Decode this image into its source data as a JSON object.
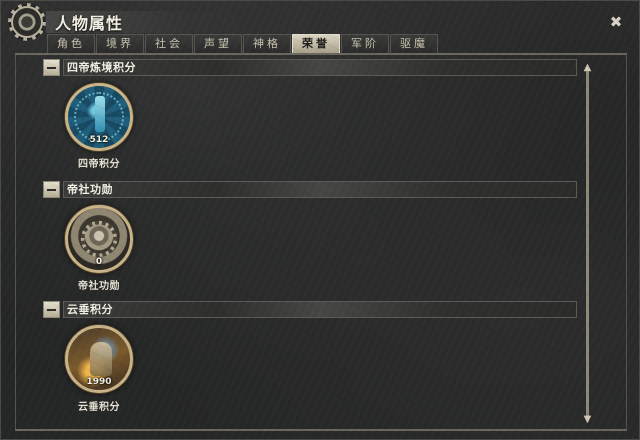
{
  "window": {
    "title": "人物属性"
  },
  "tabs": [
    {
      "label": "角色",
      "active": false
    },
    {
      "label": "境界",
      "active": false
    },
    {
      "label": "社会",
      "active": false
    },
    {
      "label": "声望",
      "active": false
    },
    {
      "label": "神格",
      "active": false
    },
    {
      "label": "荣誉",
      "active": true
    },
    {
      "label": "军阶",
      "active": false
    },
    {
      "label": "驱魔",
      "active": false
    }
  ],
  "sections": [
    {
      "header": "四帝炼境积分",
      "item": {
        "value": "512",
        "caption": "四帝积分"
      }
    },
    {
      "header": "帝社功勋",
      "item": {
        "value": "0",
        "caption": "帝社功勋"
      }
    },
    {
      "header": "云垂积分",
      "item": {
        "value": "1990",
        "caption": "云垂积分"
      }
    }
  ],
  "icons": {
    "close": "crossed-swords-close-icon",
    "logo": "gear-icon",
    "collapse": "minus-icon"
  },
  "colors": {
    "accent": "#c9b489",
    "active_tab": "#d9d3c2",
    "background": "#252626"
  }
}
